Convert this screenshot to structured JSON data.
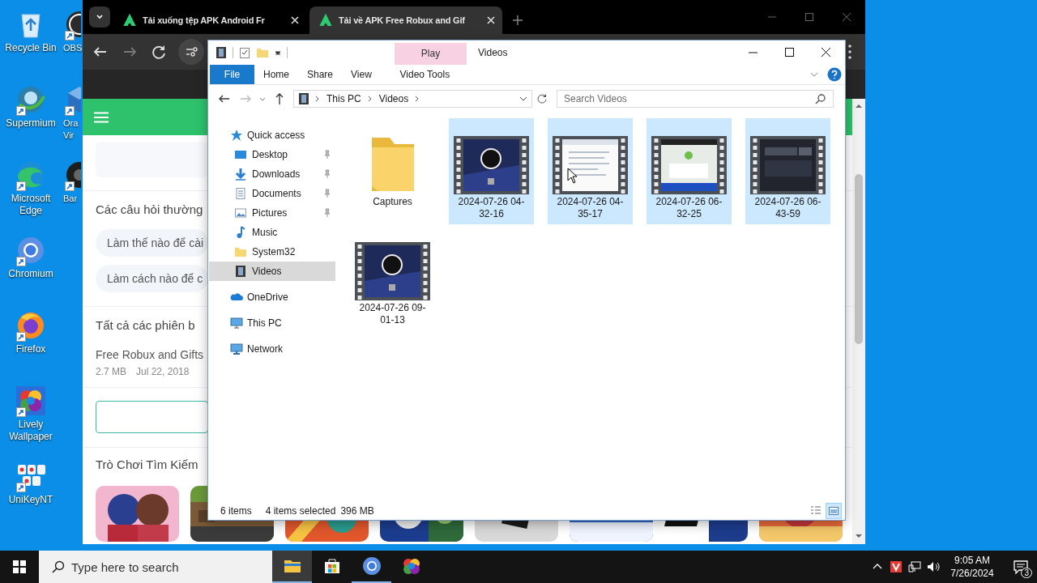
{
  "desktop": {
    "icons": [
      {
        "label": "Recycle Bin",
        "kind": "recycle",
        "shortcut": false
      },
      {
        "label": "Supermium",
        "kind": "supermium",
        "shortcut": true
      },
      {
        "label": "Microsoft Edge",
        "kind": "edge",
        "shortcut": true
      },
      {
        "label": "Chromium",
        "kind": "chromium",
        "shortcut": true
      },
      {
        "label": "Firefox",
        "kind": "firefox",
        "shortcut": true
      },
      {
        "label": "Lively Wallpaper",
        "kind": "lively",
        "shortcut": true
      },
      {
        "label": "UniKeyNT",
        "kind": "unikey",
        "shortcut": true
      }
    ],
    "partly_hidden_icons": [
      {
        "label": "OBS",
        "kind": "obs",
        "shortcut": true
      },
      {
        "label": "Ora Vir",
        "kind": "vbox",
        "shortcut": true
      },
      {
        "label": "Bar",
        "kind": "dark",
        "shortcut": true
      }
    ]
  },
  "browser": {
    "tabs": [
      {
        "title": "Tải xuống tệp APK Android Fr",
        "selected": false
      },
      {
        "title": "Tải về APK Free Robux and Gif",
        "selected": true
      }
    ],
    "page": {
      "faq_heading": "Các câu hỏi thường",
      "faq_items": [
        "Làm thế nào để cài",
        "Làm cách nào để c"
      ],
      "versions_heading": "Tất cả các phiên b",
      "version": {
        "name": "Free Robux and Gifts",
        "size": "2.7 MB",
        "date": "Jul 22, 2018"
      },
      "games_heading": "Trò Chơi Tìm Kiếm",
      "games": [
        {
          "kind": "picture"
        },
        {
          "kind": "picture"
        },
        {
          "kind": "picture"
        },
        {
          "kind": "picture"
        },
        {
          "kind": "picture"
        },
        {
          "kind": "picture"
        },
        {
          "kind": "picture"
        },
        {
          "kind": "picture"
        }
      ]
    }
  },
  "explorer": {
    "title": "Videos",
    "contextual_tab": "Play",
    "ribbon_tabs": [
      {
        "label": "File",
        "kind": "file"
      },
      {
        "label": "Home",
        "kind": "tab"
      },
      {
        "label": "Share",
        "kind": "tab"
      },
      {
        "label": "View",
        "kind": "tab"
      },
      {
        "label": "Video Tools",
        "kind": "context"
      }
    ],
    "address": {
      "path": [
        "This PC",
        "Videos"
      ]
    },
    "search": {
      "placeholder": "Search Videos"
    },
    "nav": [
      {
        "label": "Quick access",
        "kind": "star",
        "selected": false,
        "children": [
          {
            "label": "Desktop",
            "kind": "desktop",
            "pinned": true,
            "selected": false
          },
          {
            "label": "Downloads",
            "kind": "downloads",
            "pinned": true,
            "selected": false
          },
          {
            "label": "Documents",
            "kind": "documents",
            "pinned": true,
            "selected": false
          },
          {
            "label": "Pictures",
            "kind": "pictures",
            "pinned": true,
            "selected": false
          },
          {
            "label": "Music",
            "kind": "music",
            "pinned": false,
            "selected": false
          },
          {
            "label": "System32",
            "kind": "folder",
            "pinned": false,
            "selected": false
          },
          {
            "label": "Videos",
            "kind": "videos",
            "pinned": false,
            "selected": true
          }
        ]
      },
      {
        "label": "OneDrive",
        "kind": "onedrive",
        "selected": false
      },
      {
        "label": "This PC",
        "kind": "pc",
        "selected": false
      },
      {
        "label": "Network",
        "kind": "network",
        "selected": false
      }
    ],
    "files": [
      {
        "name": "Captures",
        "kind": "folder",
        "selected": false
      },
      {
        "name": "2024-07-26 04-32-16",
        "kind": "video",
        "selected": true
      },
      {
        "name": "2024-07-26 04-35-17",
        "kind": "video",
        "selected": true
      },
      {
        "name": "2024-07-26 06-32-25",
        "kind": "video",
        "selected": true
      },
      {
        "name": "2024-07-26 06-43-59",
        "kind": "video",
        "selected": true
      },
      {
        "name": "2024-07-26 09-01-13",
        "kind": "video",
        "selected": false
      }
    ],
    "status": {
      "count": "6 items",
      "selection": "4 items selected",
      "size": "396 MB"
    },
    "views": [
      {
        "kind": "details",
        "selected": false
      },
      {
        "kind": "large-icons",
        "selected": true
      }
    ]
  },
  "taskbar": {
    "search_placeholder": "Type here to search",
    "apps": [
      {
        "kind": "explorer",
        "active": true,
        "running": true
      },
      {
        "kind": "store",
        "active": false,
        "running": false
      },
      {
        "kind": "chromium",
        "active": false,
        "running": true
      },
      {
        "kind": "lively",
        "active": false,
        "running": false
      }
    ],
    "time": "9:05 AM",
    "date": "7/26/2024",
    "notifications": "3"
  }
}
